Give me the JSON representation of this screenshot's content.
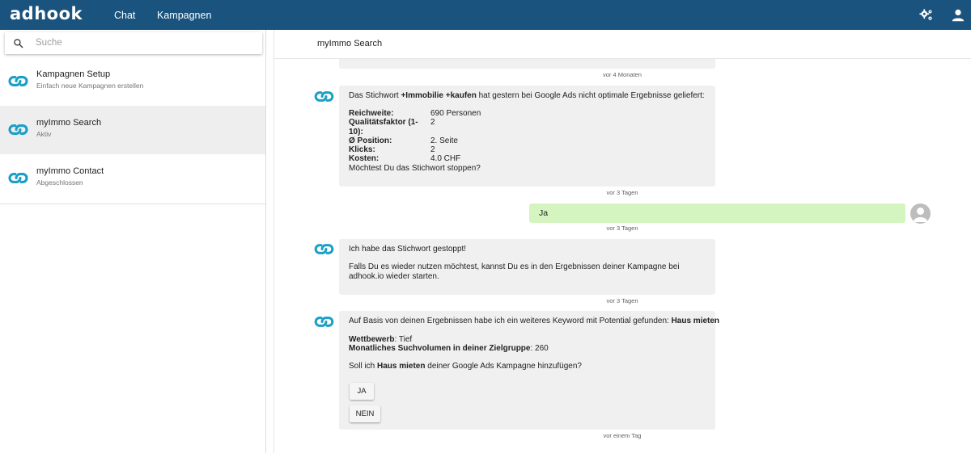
{
  "app": {
    "logo": "adhook"
  },
  "topnav": {
    "chat": "Chat",
    "campaigns": "Kampagnen"
  },
  "icons": {
    "settings": "gears-icon",
    "account": "person-icon",
    "search": "search-icon",
    "bot": "adhook-chain-logo-icon"
  },
  "colors": {
    "topbar": "#1a537e",
    "accent": "#1b9fc6",
    "user_bubble": "#d5f5c0",
    "bot_bubble": "#f0f0f0"
  },
  "sidebar": {
    "search_placeholder": "Suche",
    "campaigns": [
      {
        "title": "Kampagnen Setup",
        "subtitle": "Einfach neue Kampagnen erstellen"
      },
      {
        "title": "myImmo Search",
        "subtitle": "Aktiv",
        "active": true
      },
      {
        "title": "myImmo Contact",
        "subtitle": "Abgeschlossen"
      }
    ]
  },
  "chat": {
    "title": "myImmo Search",
    "timestamps": [
      "vor 4 Monaten",
      "vor 3 Tagen",
      "vor 3 Tagen",
      "vor 3 Tagen",
      "vor einem Tag"
    ],
    "msg1": {
      "intro_pre": "Das Stichwort ",
      "intro_keyword": "+Immobilie +kaufen",
      "intro_post": " hat gestern bei Google Ads nicht optimale Ergebnisse geliefert:",
      "stats": [
        {
          "label": "Reichweite:",
          "value": "690 Personen"
        },
        {
          "label": "Qualitätsfaktor (1-10):",
          "value": "2"
        },
        {
          "label": "Ø Position:",
          "value": "2. Seite"
        },
        {
          "label": "Klicks:",
          "value": "2"
        },
        {
          "label": "Kosten:",
          "value": "4.0 CHF"
        }
      ],
      "question": "Möchtest Du das Stichwort stoppen?"
    },
    "user_reply": "Ja",
    "msg2": {
      "line1": "Ich habe das Stichwort gestoppt!",
      "line2": "Falls Du es wieder nutzen möchtest, kannst Du es in den Ergebnissen deiner Kampagne bei adhook.io wieder starten."
    },
    "msg3": {
      "intro": "Auf Basis von deinen Ergebnissen habe ich ein weiteres Keyword mit Potential gefunden: ",
      "keyword": "Haus mieten",
      "competition_label": "Wettbewerb",
      "competition_value": ": Tief",
      "volume_label": "Monatliches Suchvolumen in deiner Zielgruppe",
      "volume_value": ": 260",
      "q_pre": "Soll ich ",
      "q_keyword": "Haus mieten",
      "q_post": " deiner Google Ads Kampagne hinzufügen?",
      "btn_yes": "JA",
      "btn_no": "NEIN"
    }
  }
}
